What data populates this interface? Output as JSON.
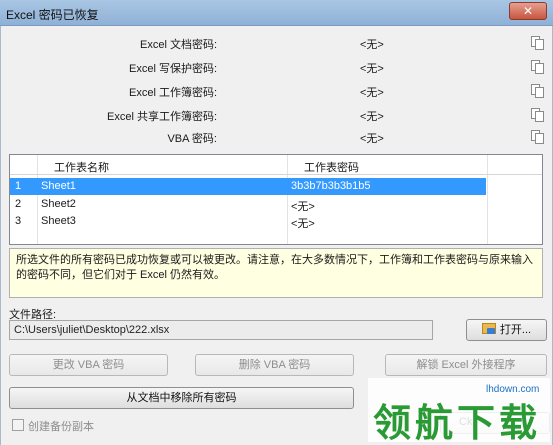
{
  "window": {
    "title": "Excel 密码已恢复",
    "close_glyph": "✕"
  },
  "passwords": [
    {
      "label": "Excel 文档密码:",
      "value": "<无>"
    },
    {
      "label": "Excel 写保护密码:",
      "value": "<无>"
    },
    {
      "label": "Excel 工作簿密码:",
      "value": "<无>"
    },
    {
      "label": "Excel 共享工作簿密码:",
      "value": "<无>"
    },
    {
      "label": "VBA 密码:",
      "value": "<无>"
    }
  ],
  "sheet_table": {
    "columns": [
      "工作表名称",
      "工作表密码"
    ],
    "rows": [
      {
        "num": "1",
        "name": "Sheet1",
        "password": "3b3b7b3b3b1b5",
        "selected": true
      },
      {
        "num": "2",
        "name": "Sheet2",
        "password": "<无>",
        "selected": false
      },
      {
        "num": "3",
        "name": "Sheet3",
        "password": "<无>",
        "selected": false
      }
    ]
  },
  "message": "所选文件的所有密码已成功恢复或可以被更改。请注意，在大多数情况下，工作簿和工作表密码与原来输入的密码不同，但它们对于 Excel 仍然有效。",
  "file_path": {
    "label": "文件路径:",
    "value": "C:\\Users\\juliet\\Desktop\\222.xlsx"
  },
  "buttons": {
    "open": "打开...",
    "change_vba": "更改 VBA 密码",
    "remove_vba": "删除 VBA 密码",
    "unlock_addin": "解锁 Excel 外接程序",
    "remove_all": "从文档中移除所有密码",
    "bottom_partial": "Ck"
  },
  "backup": {
    "label": "创建备份副本",
    "checked": false
  },
  "watermark": {
    "logo": "领航下载",
    "url": "lhdown.com"
  },
  "icons": {
    "copy": "copy-icon",
    "folder": "folder-open-icon"
  }
}
